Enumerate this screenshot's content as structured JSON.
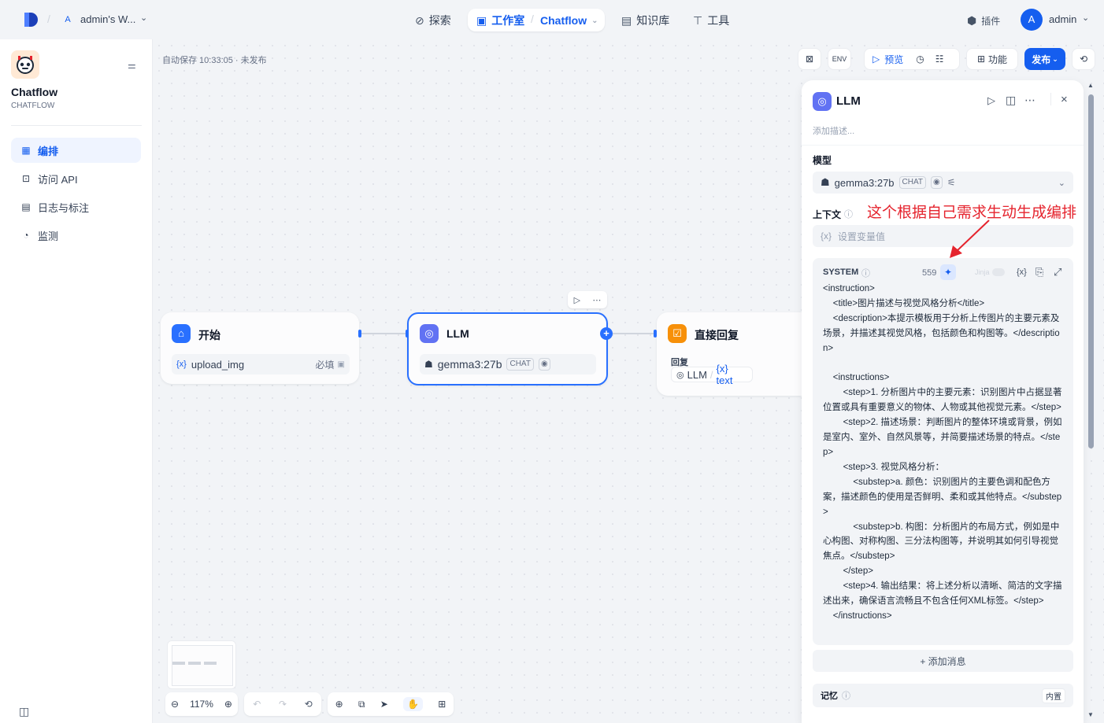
{
  "topbar": {
    "workspace_badge": "A",
    "workspace_name": "admin's W...",
    "nav": {
      "explore": "探索",
      "studio": "工作室",
      "app": "Chatflow",
      "knowledge": "知识库",
      "tools": "工具"
    },
    "plugins": "插件",
    "user_initial": "A",
    "user_name": "admin"
  },
  "sidebar": {
    "app_name": "Chatflow",
    "app_type": "CHATFLOW",
    "items": [
      {
        "label": "编排"
      },
      {
        "label": "访问 API"
      },
      {
        "label": "日志与标注"
      },
      {
        "label": "监测"
      }
    ]
  },
  "canvas": {
    "autosave": "自动保存 10:33:05 · 未发布",
    "toolbar": {
      "preview": "预览",
      "features": "功能",
      "publish": "发布"
    },
    "zoom": "117%",
    "nodes": {
      "start": {
        "title": "开始",
        "var_prefix": "{x}",
        "var_name": "upload_img",
        "required": "必填"
      },
      "llm": {
        "title": "LLM",
        "model": "gemma3:27b",
        "tag": "CHAT"
      },
      "answer": {
        "title": "直接回复",
        "section": "回复",
        "ref_node": "LLM",
        "ref_sep": "/",
        "ref_var": "{x} text"
      }
    }
  },
  "panel": {
    "title": "LLM",
    "desc_placeholder": "添加描述...",
    "model_label": "模型",
    "model_name": "gemma3:27b",
    "model_tag": "CHAT",
    "context_label": "上下文",
    "context_placeholder": "设置变量值",
    "context_prefix": "{x}",
    "system_label": "SYSTEM",
    "token_count": "559",
    "jinja": "Jinja",
    "var_button": "{x}",
    "prompt": "<instruction>\n    <title>图片描述与视觉风格分析</title>\n    <description>本提示模板用于分析上传图片的主要元素及场景，并描述其视觉风格，包括颜色和构图等。</description>\n\n    <instructions>\n        <step>1. 分析图片中的主要元素：识别图片中占据显著位置或具有重要意义的物体、人物或其他视觉元素。</step>\n        <step>2. 描述场景：判断图片的整体环境或背景，例如是室内、室外、自然风景等，并简要描述场景的特点。</step>\n        <step>3. 视觉风格分析：\n            <substep>a. 颜色：识别图片的主要色调和配色方案，描述颜色的使用是否鲜明、柔和或其他特点。</substep>\n            <substep>b. 构图：分析图片的布局方式，例如是中心构图、对称构图、三分法构图等，并说明其如何引导视觉焦点。</substep>\n        </step>\n        <step>4. 输出结果：将上述分析以清晰、简洁的文字描述出来，确保语言流畅且不包含任何XML标签。</step>\n    </instructions>",
    "add_message": "+ 添加消息",
    "memory_label": "记忆",
    "memory_tag": "内置"
  },
  "annotation": "这个根据自己需求生动生成编排",
  "colors": {
    "accent": "#155eef",
    "annotation": "#e5242e",
    "start_icon": "#2970ff",
    "llm_icon": "#6172f3",
    "answer_icon": "#f79009"
  }
}
